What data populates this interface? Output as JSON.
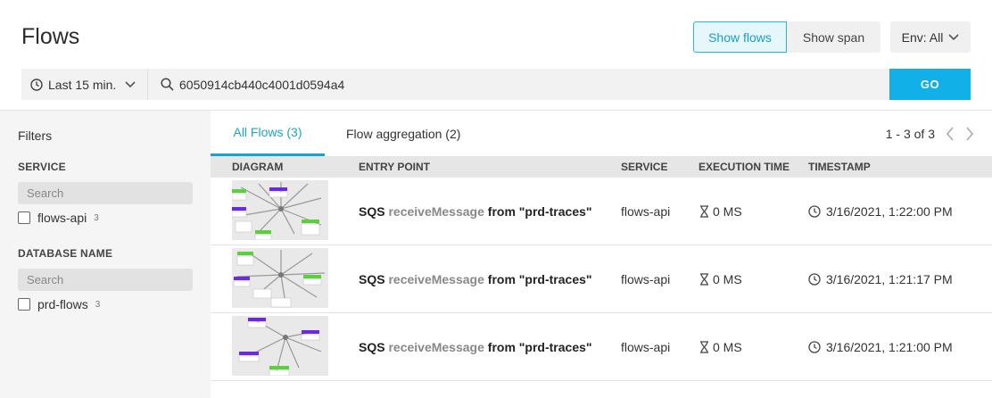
{
  "header": {
    "title": "Flows",
    "show_flows": "Show flows",
    "show_span": "Show span",
    "env": "Env: All"
  },
  "search": {
    "time_range": "Last 15 min.",
    "query": "6050914cb440c4001d0594a4",
    "go": "GO"
  },
  "sidebar": {
    "title": "Filters",
    "sections": [
      {
        "label": "SERVICE",
        "search_placeholder": "Search",
        "items": [
          {
            "label": "flows-api",
            "count": "3"
          }
        ]
      },
      {
        "label": "DATABASE NAME",
        "search_placeholder": "Search",
        "items": [
          {
            "label": "prd-flows",
            "count": "3"
          }
        ]
      }
    ]
  },
  "tabs": [
    {
      "label": "All Flows (3)",
      "active": true
    },
    {
      "label": "Flow aggregation (2)",
      "active": false
    }
  ],
  "pager": {
    "label": "1 - 3 of 3"
  },
  "table": {
    "columns": [
      "DIAGRAM",
      "ENTRY POINT",
      "SERVICE",
      "EXECUTION TIME",
      "TIMESTAMP"
    ],
    "rows": [
      {
        "entry_prefix": "SQS",
        "entry_method": "receiveMessage",
        "entry_suffix": "from \"prd-traces\"",
        "service": "flows-api",
        "exec": "0 MS",
        "timestamp": "3/16/2021, 1:22:00 PM"
      },
      {
        "entry_prefix": "SQS",
        "entry_method": "receiveMessage",
        "entry_suffix": "from \"prd-traces\"",
        "service": "flows-api",
        "exec": "0 MS",
        "timestamp": "3/16/2021, 1:21:17 PM"
      },
      {
        "entry_prefix": "SQS",
        "entry_method": "receiveMessage",
        "entry_suffix": "from \"prd-traces\"",
        "service": "flows-api",
        "exec": "0 MS",
        "timestamp": "3/16/2021, 1:21:00 PM"
      }
    ]
  },
  "colors": {
    "accent": "#1aa3cf",
    "go_button": "#11b0e8",
    "node_purple": "#6a2bd9",
    "node_green": "#5ccf3c"
  }
}
